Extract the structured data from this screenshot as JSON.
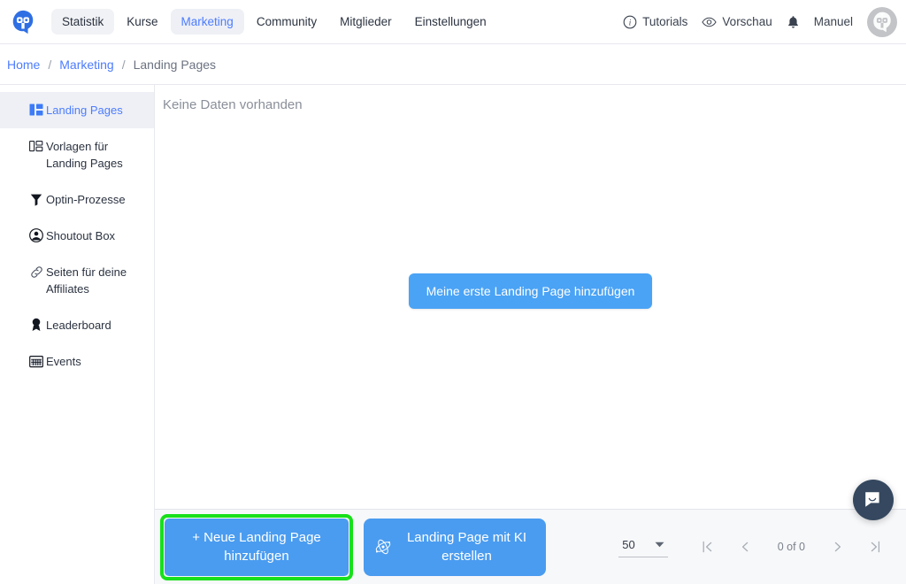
{
  "header": {
    "logo_icon": "robot-logo-icon",
    "nav_items": [
      {
        "label": "Statistik",
        "state": "hovered"
      },
      {
        "label": "Kurse",
        "state": "default"
      },
      {
        "label": "Marketing",
        "state": "active"
      },
      {
        "label": "Community",
        "state": "default"
      },
      {
        "label": "Mitglieder",
        "state": "default"
      },
      {
        "label": "Einstellungen",
        "state": "default"
      }
    ],
    "tutorials_label": "Tutorials",
    "tutorials_icon": "info-circle-icon",
    "preview_label": "Vorschau",
    "preview_icon": "eye-icon",
    "notifications_icon": "bell-icon",
    "user_name": "Manuel",
    "avatar_icon": "robot-avatar-icon",
    "accent_color": "#4d7cfe"
  },
  "breadcrumb": {
    "items": [
      {
        "label": "Home",
        "link": true
      },
      {
        "label": "Marketing",
        "link": true
      },
      {
        "label": "Landing Pages",
        "link": false
      }
    ],
    "separator": "/"
  },
  "sidebar": {
    "items": [
      {
        "label": "Landing Pages",
        "icon": "layout-columns-icon",
        "active": true
      },
      {
        "label": "Vorlagen für Landing Pages",
        "icon": "template-grid-icon",
        "active": false
      },
      {
        "label": "Optin-Prozesse",
        "icon": "funnel-icon",
        "active": false
      },
      {
        "label": "Shoutout Box",
        "icon": "user-circle-icon",
        "active": false
      },
      {
        "label": "Seiten für deine Affiliates",
        "icon": "link-icon",
        "active": false
      },
      {
        "label": "Leaderboard",
        "icon": "award-medal-icon",
        "active": false
      },
      {
        "label": "Events",
        "icon": "calendar-icon",
        "active": false
      }
    ]
  },
  "main": {
    "empty_state_text": "Keine Daten vorhanden",
    "center_cta_label": "Meine erste Landing Page hinzufügen"
  },
  "footer": {
    "new_page_button_label": "+ Neue Landing Page hinzufügen",
    "new_page_button_highlight_color": "#18e01a",
    "ai_button_label": "Landing Page mit KI erstellen",
    "ai_button_icon": "ai-atom-icon",
    "button_color": "#4a9cf0",
    "pagination": {
      "page_size_value": "50",
      "page_size_icon": "chevron-down-icon",
      "first_page_icon": "first-page-icon",
      "prev_page_icon": "prev-page-icon",
      "range_label": "0 of 0",
      "next_page_icon": "next-page-icon",
      "last_page_icon": "last-page-icon"
    }
  },
  "widgets": {
    "intercom_icon": "chat-bubble-smile-icon",
    "intercom_color": "#35485f"
  }
}
